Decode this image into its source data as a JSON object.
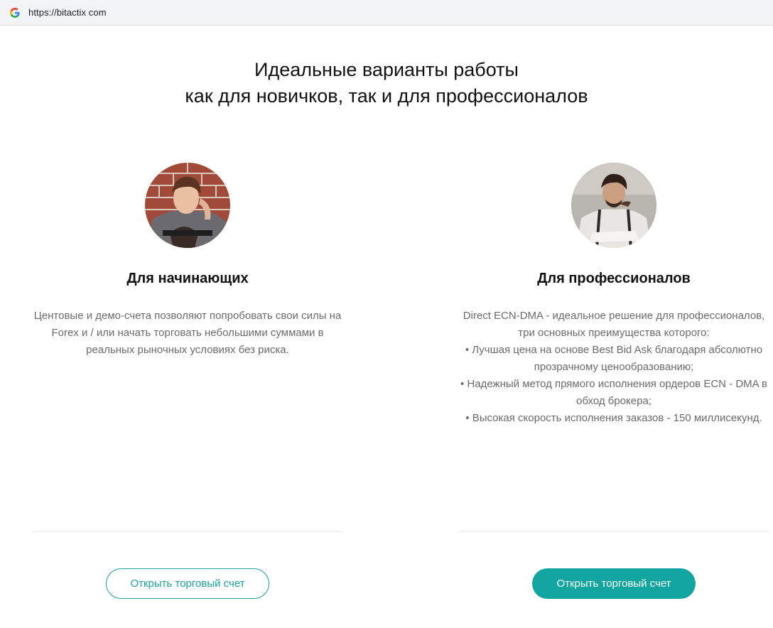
{
  "browser": {
    "url": "https://bitactix com",
    "icon": "google-g-icon"
  },
  "headline": {
    "line1": "Идеальные варианты работы",
    "line2": "как для новичков, так и для профессионалов"
  },
  "beginners": {
    "title": "Для начинающих",
    "text": "Центовые и демо-счета позволяют попробовать свои силы на Forex и / или начать торговать небольшими суммами в реальных рыночных условиях без риска.",
    "button_label": "Открыть торговый счет"
  },
  "pros": {
    "title": "Для профессионалов",
    "text_lines": [
      "Direct ECN-DMA - идеальное решение для профессионалов, три основных преимущества которого:",
      "• Лучшая цена на основе Best Bid Ask благодаря абсолютно прозрачному ценообразованию;",
      "• Надежный метод прямого исполнения ордеров ECN - DMA в обход брокера;",
      "• Высокая скорость исполнения заказов - 150 миллисекунд."
    ],
    "button_label": "Открыть торговый счет"
  },
  "colors": {
    "accent": "#13a6a0",
    "text_muted": "#6b6b6b"
  }
}
